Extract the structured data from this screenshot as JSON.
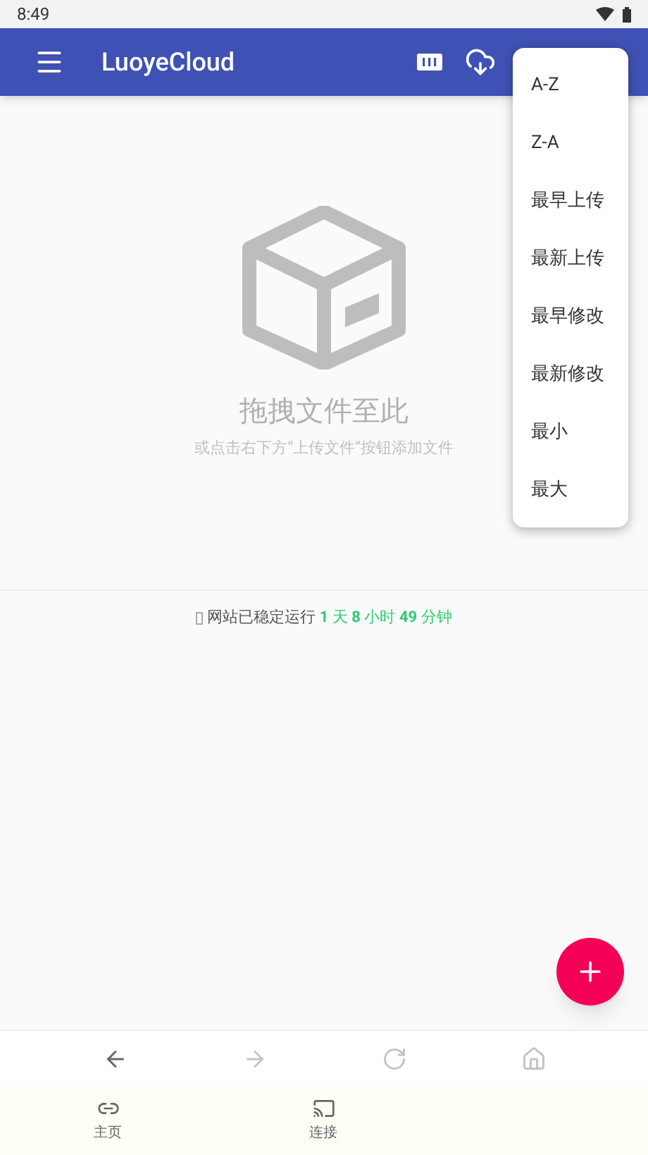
{
  "status_bar": {
    "time": "8:49"
  },
  "app_bar": {
    "title": "LuoyeCloud"
  },
  "empty_state": {
    "title": "拖拽文件至此",
    "hint": "或点击右下方“上传文件”按钮添加文件"
  },
  "uptime": {
    "prefix": "网站已稳定运行",
    "parts": [
      {
        "text": "1",
        "kind": "number"
      },
      {
        "text": "天",
        "kind": "unit"
      },
      {
        "text": "8",
        "kind": "number"
      },
      {
        "text": "小时",
        "kind": "unit"
      },
      {
        "text": "49",
        "kind": "number"
      },
      {
        "text": "分钟",
        "kind": "unit"
      }
    ]
  },
  "sort_menu": {
    "items": [
      "A-Z",
      "Z-A",
      "最早上传",
      "最新上传",
      "最早修改",
      "最新修改",
      "最小",
      "最大"
    ]
  },
  "browser_bar": {
    "buttons": [
      {
        "kind": "back",
        "disabled": false
      },
      {
        "kind": "forward",
        "disabled": true
      },
      {
        "kind": "refresh",
        "disabled": true
      },
      {
        "kind": "home",
        "disabled": true
      }
    ]
  },
  "bottom_nav": {
    "items": [
      {
        "label": "主页",
        "kind": "link"
      },
      {
        "label": "连接",
        "kind": "cast"
      }
    ]
  }
}
